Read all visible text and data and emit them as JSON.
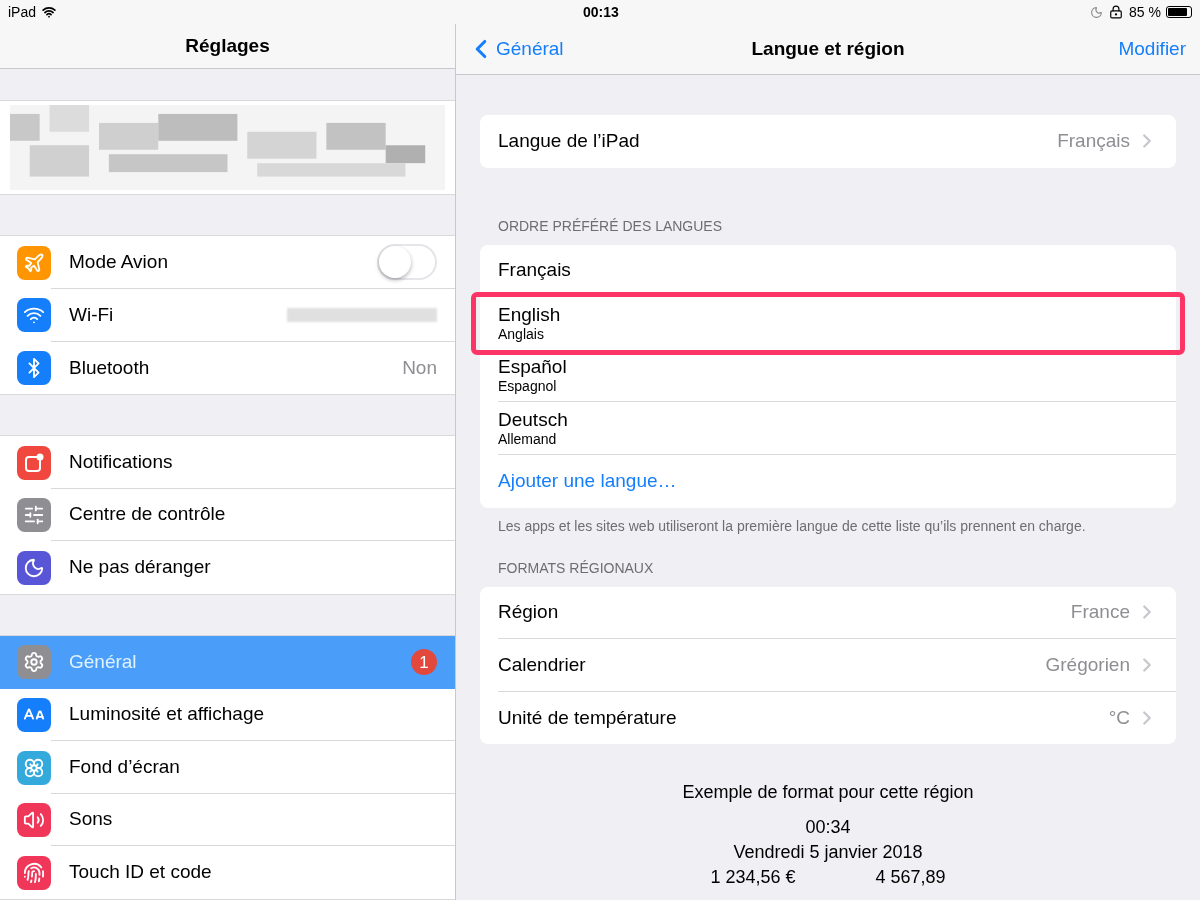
{
  "status_bar": {
    "carrier": "iPad",
    "time": "00:13",
    "battery": "85 %"
  },
  "sidebar": {
    "title": "Réglages",
    "groups": [
      {
        "items": [
          {
            "label": "Mode Avion",
            "color": "#ff9500",
            "kind": "toggle",
            "on": false,
            "selected": false
          },
          {
            "label": "Wi-Fi",
            "color": "#147efb",
            "kind": "blurred",
            "selected": false
          },
          {
            "label": "Bluetooth",
            "color": "#147efb",
            "kind": "value",
            "value": "Non",
            "selected": false
          }
        ]
      },
      {
        "items": [
          {
            "label": "Notifications",
            "color": "#f0483e",
            "kind": "plain",
            "selected": false
          },
          {
            "label": "Centre de contrôle",
            "color": "#8e8e93",
            "kind": "plain",
            "selected": false
          },
          {
            "label": "Ne pas déranger",
            "color": "#5856d6",
            "kind": "plain",
            "selected": false
          }
        ]
      },
      {
        "items": [
          {
            "label": "Général",
            "color": "#8e8e93",
            "kind": "badge",
            "badge": "1",
            "selected": true
          },
          {
            "label": "Luminosité et affichage",
            "color": "#147efb",
            "kind": "plain",
            "selected": false
          },
          {
            "label": "Fond d’écran",
            "color": "#34aadc",
            "kind": "plain",
            "selected": false
          },
          {
            "label": "Sons",
            "color": "#f0375a",
            "kind": "plain",
            "selected": false
          },
          {
            "label": "Touch ID et code",
            "color": "#f0375a",
            "kind": "plain",
            "selected": false
          }
        ]
      }
    ]
  },
  "detail": {
    "back": "Général",
    "title": "Langue et région",
    "action": "Modifier",
    "device_language": {
      "label": "Langue de l’iPad",
      "value": "Français"
    },
    "languages_header": "ORDRE PRÉFÉRÉ DES LANGUES",
    "languages": [
      {
        "name": "Français",
        "highlighted": false
      },
      {
        "name": "English",
        "native": "Anglais",
        "highlighted": true
      },
      {
        "name": "Español",
        "native": "Espagnol",
        "highlighted": false
      },
      {
        "name": "Deutsch",
        "native": "Allemand",
        "highlighted": false
      }
    ],
    "add_language": "Ajouter une langue…",
    "languages_footer": "Les apps et les sites web utiliseront la première langue de cette liste qu’ils prennent en charge.",
    "formats_header": "FORMATS RÉGIONAUX",
    "formats": [
      {
        "label": "Région",
        "value": "France"
      },
      {
        "label": "Calendrier",
        "value": "Grégorien"
      },
      {
        "label": "Unité de température",
        "value": "°C"
      }
    ],
    "example_title": "Exemple de format pour cette région",
    "example_time": "00:34",
    "example_date": "Vendredi 5 janvier 2018",
    "example_numbers": [
      "1 234,56 €",
      "4 567,89"
    ]
  }
}
